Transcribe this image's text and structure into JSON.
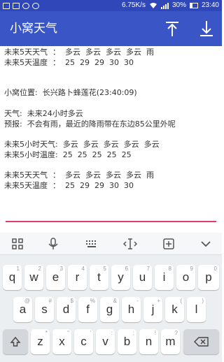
{
  "status_bar": {
    "speed": "6.75K/s",
    "battery": "30%",
    "time": "23:40"
  },
  "app_bar": {
    "title": "小窝天气",
    "actions": [
      "upload-icon",
      "download-icon"
    ]
  },
  "content": {
    "lines": [
      "未来5天天气  ：  多云  多云  多云  多云  雨",
      "未来5天温度  ：  25  29  29  30  30",
      "",
      "小窝位置:  长兴路卜蜂莲花(23:40:09)",
      "",
      "天气:  未来24小时多云",
      "预报:  不会有雨，最近的降雨带在东边85公里外呢",
      "",
      "未来5小时天气:  多云  多云  多云  多云  多云",
      "未来5小时温度:  25  25  25  25  25",
      "",
      "未来5天天气  ：  多云  多云  多云  多云  雨",
      "未来5天温度  ：  25  29  29  30  30"
    ]
  },
  "accent_color": "#e23c6f",
  "brand_color": "#3a55c6",
  "keyboard": {
    "toolbar": [
      "grid-icon",
      "mic-icon",
      "keyboard-icon",
      "cursor-icon",
      "add-box-icon",
      "chevron-down-icon"
    ],
    "row1": [
      {
        "key": "q",
        "hint": "1"
      },
      {
        "key": "w",
        "hint": "2"
      },
      {
        "key": "e",
        "hint": "3"
      },
      {
        "key": "r",
        "hint": "4"
      },
      {
        "key": "t",
        "hint": "5"
      },
      {
        "key": "y",
        "hint": "6"
      },
      {
        "key": "u",
        "hint": "7"
      },
      {
        "key": "i",
        "hint": "8"
      },
      {
        "key": "o",
        "hint": "9"
      },
      {
        "key": "p",
        "hint": "0"
      }
    ],
    "row2": [
      {
        "key": "a",
        "hint": "@"
      },
      {
        "key": "s",
        "hint": "#"
      },
      {
        "key": "d",
        "hint": "$"
      },
      {
        "key": "f",
        "hint": "%"
      },
      {
        "key": "g",
        "hint": "&"
      },
      {
        "key": "h",
        "hint": "-"
      },
      {
        "key": "j",
        "hint": "+"
      },
      {
        "key": "k",
        "hint": "("
      },
      {
        "key": "l",
        "hint": ")"
      }
    ],
    "row3": [
      {
        "key": "z",
        "hint": "*"
      },
      {
        "key": "x",
        "hint": "\""
      },
      {
        "key": "c",
        "hint": "'"
      },
      {
        "key": "v",
        "hint": ":"
      },
      {
        "key": "b",
        "hint": ";"
      },
      {
        "key": "n",
        "hint": "!"
      },
      {
        "key": "m",
        "hint": "?"
      }
    ]
  }
}
